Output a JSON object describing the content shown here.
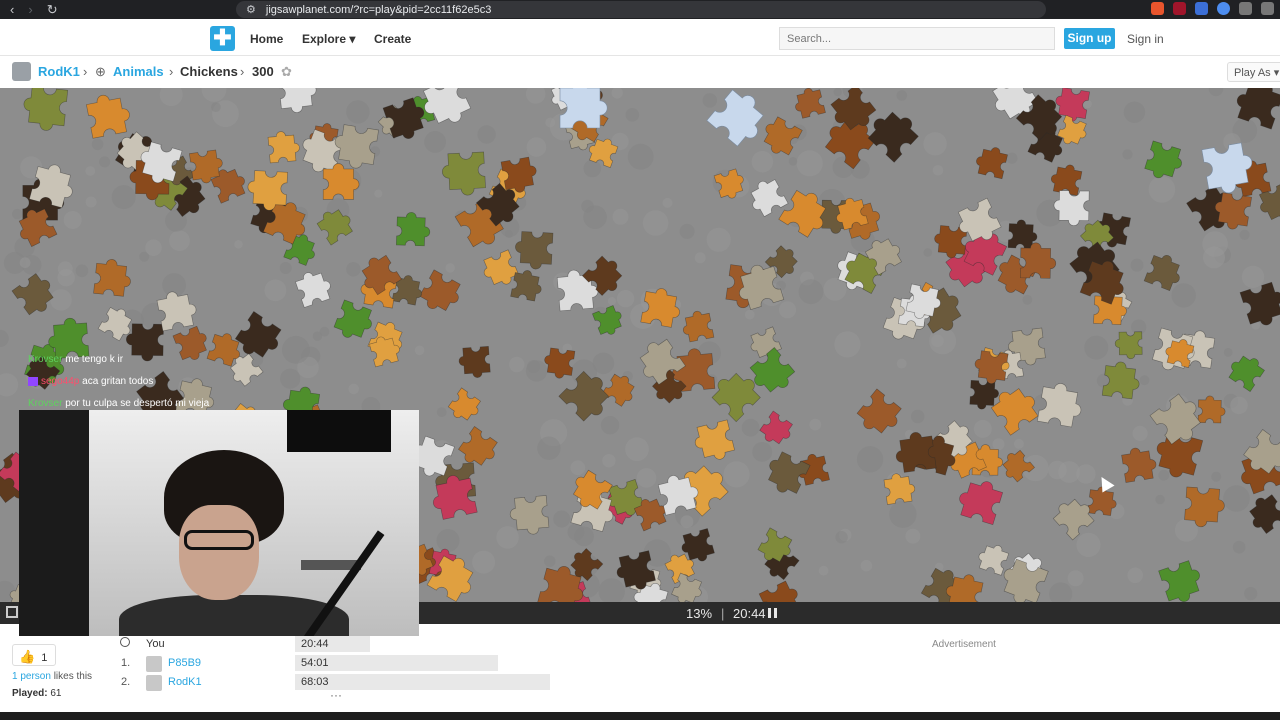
{
  "browser": {
    "url": "jigsawplanet.com/?rc=play&pid=2cc11f62e5c3",
    "nav_back": "‹",
    "nav_forward": "›",
    "reload": "↻"
  },
  "header": {
    "home": "Home",
    "explore": "Explore ▾",
    "create": "Create",
    "search_placeholder": "Search...",
    "signup": "Sign up",
    "signin": "Sign in"
  },
  "breadcrumb": {
    "user": "RodK1",
    "category": "Animals",
    "puzzle": "Chickens",
    "pieces": "300",
    "play_as": "Play As ▾"
  },
  "chat": [
    {
      "user": "Krovser",
      "text": "me tengo k ir"
    },
    {
      "user": "sego44p",
      "text": "aca gritan todos"
    },
    {
      "user": "Krovser",
      "text": "por tu culpa se despertó mi vieja"
    }
  ],
  "status": {
    "progress": "13%",
    "progress_value": 13,
    "separator": "|",
    "time": "20:44"
  },
  "likes": {
    "count": "1",
    "people_link": "1 person",
    "likes_suffix": " likes this",
    "played_label": "Played:",
    "played_value": " 61"
  },
  "scores": {
    "you_label": "You",
    "you_time": "20:44",
    "rows": [
      {
        "rank": "1.",
        "name": "P85B9",
        "time": "54:01"
      },
      {
        "rank": "2.",
        "name": "RodK1",
        "time": "68:03"
      }
    ],
    "more": "···"
  },
  "advert": "Advertisement",
  "colors": {
    "accent": "#2aa6e0",
    "board": "#8d8d8d"
  }
}
